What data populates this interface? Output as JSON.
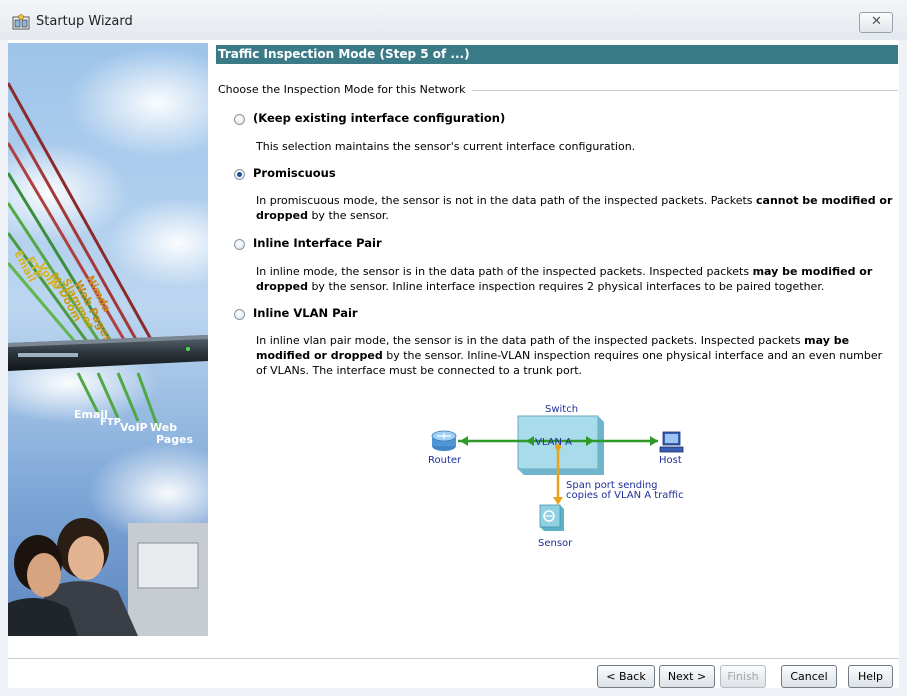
{
  "window": {
    "title": "Startup Wizard"
  },
  "step": {
    "header": "Traffic Inspection Mode (Step 5 of ...)",
    "group_label": "Choose the Inspection Mode for this Network"
  },
  "options": [
    {
      "label": "(Keep existing interface configuration)",
      "selected": false,
      "desc": "This selection maintains the sensor's current interface configuration."
    },
    {
      "label": "Promiscuous",
      "selected": true,
      "desc_a": "In promiscuous mode, the sensor is not in the data path of the inspected packets. Packets ",
      "desc_b": "cannot be modified or dropped",
      "desc_c": " by the sensor."
    },
    {
      "label": "Inline Interface Pair",
      "selected": false,
      "desc_a": "In inline mode, the sensor is in the data path of the inspected packets. Inspected packets ",
      "desc_b": "may be modified or dropped",
      "desc_c": " by the sensor. Inline interface inspection requires 2 physical interfaces to be paired together."
    },
    {
      "label": "Inline VLAN Pair",
      "selected": false,
      "desc_a": "In inline vlan pair mode, the sensor is in the data path of the inspected packets. Inspected packets ",
      "desc_b": "may be modified or dropped",
      "desc_c": " by the sensor. Inline-VLAN inspection requires one physical interface and an even number of VLANs. The interface must be connected to a trunk port."
    }
  ],
  "diagram": {
    "switch_label": "Switch",
    "vlan_label": "VLAN A",
    "router_label": "Router",
    "host_label": "Host",
    "sensor_label": "Sensor",
    "span_line1": "Span port sending",
    "span_line2": "copies of VLAN A traffic"
  },
  "side_image": {
    "top_words": [
      "Nimda",
      "Web Pages",
      "Slammer",
      "MyDoom",
      "VoIP",
      "FTP",
      "Email"
    ],
    "bottom_words": [
      "Email",
      "FTP",
      "VoIP",
      "Web",
      "Pages"
    ]
  },
  "buttons": {
    "back": "< Back",
    "next": "Next >",
    "finish": "Finish",
    "cancel": "Cancel",
    "help": "Help"
  },
  "colors": {
    "header_bar": "#3b7a87",
    "green_link": "#2f9a2a",
    "orange_link": "#e8a21c",
    "label_blue": "#1f2f9a"
  }
}
